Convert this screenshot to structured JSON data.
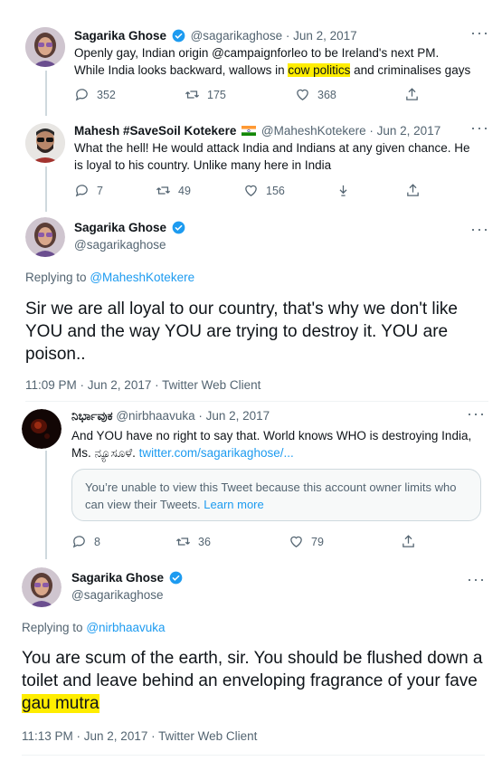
{
  "tweets": [
    {
      "name": "Sagarika Ghose",
      "handle": "@sagarikaghose",
      "date": "· Jun 2, 2017",
      "text_a": "Openly gay, Indian origin @campaignforleo to be Ireland's next PM. While India looks backward, wallows in ",
      "text_hl": "cow politics",
      "text_b": " and criminalises gays",
      "replies": "352",
      "retweets": "175",
      "likes": "368"
    },
    {
      "name": "Mahesh #SaveSoil Kotekere",
      "handle": "@MaheshKotekere",
      "date": "· Jun 2, 2017",
      "text": "What the hell! He would attack India and Indians at any given chance. He is loyal to his country. Unlike many here in India",
      "replies": "7",
      "retweets": "49",
      "likes": "156"
    },
    {
      "name": "Sagarika Ghose",
      "handle": "@sagarikaghose",
      "replying_label": "Replying to",
      "replying_to": "@MaheshKotekere",
      "text": "Sir we are all loyal to our country, that's why we don't like YOU and the way YOU are trying to destroy it. YOU are poison..",
      "meta": "11:09 PM · Jun 2, 2017 · Twitter Web Client"
    },
    {
      "name": "ನಿರ್ಭಾವುಕ",
      "handle": "@nirbhaavuka",
      "date": "· Jun 2, 2017",
      "text": "And YOU have no right to say that. World knows WHO is destroying India, Ms. ನ್ಯೂಸೂಳೆ. ",
      "link": "twitter.com/sagarikaghose/...",
      "notice_text": "You’re unable to view this Tweet because this account owner limits who can view their Tweets. ",
      "notice_link": "Learn more",
      "replies": "8",
      "retweets": "36",
      "likes": "79"
    },
    {
      "name": "Sagarika Ghose",
      "handle": "@sagarikaghose",
      "replying_label": "Replying to",
      "replying_to": "@nirbhaavuka",
      "text_a": "You are scum of the earth, sir. You should be flushed down a toilet and leave behind an enveloping fragrance of your fave",
      "text_hl": "gau mutra",
      "meta": "11:13 PM · Jun 2, 2017 · Twitter Web Client"
    }
  ],
  "icons": {
    "verified": "verified-badge-icon",
    "flag": "indian-flag-icon",
    "reply": "reply-icon",
    "retweet": "retweet-icon",
    "like": "heart-icon",
    "share": "share-icon",
    "more": "more-icon"
  },
  "colors": {
    "accent": "#1d9bf0",
    "highlight": "#ffed00",
    "muted": "#536471"
  }
}
